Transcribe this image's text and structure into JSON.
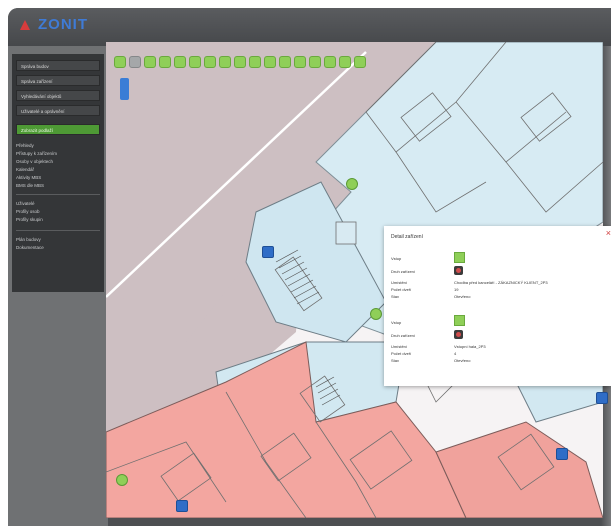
{
  "app": {
    "title": "ZONIT"
  },
  "sidebar": {
    "buttons": [
      "Správa budov",
      "Správa zařízení",
      "Vyhledávání objektů",
      "Uživatelé a oprávnění",
      "Zobrazit podlaží"
    ],
    "links1": [
      "Přehledy",
      "Přístupy k zařízením",
      "Osoby v objektech",
      "Kalendář",
      "Aktivity MBS",
      "BMS dle MBS"
    ],
    "links2": [
      "Uživatelé",
      "Profily osob",
      "Profily skupin"
    ],
    "links3": [
      "Plán budovy",
      "Dokumentace"
    ]
  },
  "toolbar": {
    "count": 17
  },
  "popup": {
    "title": "Detail zařízení",
    "sections": [
      {
        "header": "Vstup",
        "rows": [
          {
            "label": "Druh zařízení",
            "value": ""
          },
          {
            "label": "Umístění",
            "value": "Chodba před kanceláří - ZÁKAZNICKÝ KLIENT_2P3"
          },
          {
            "label": "Počet dveří",
            "value": "19"
          },
          {
            "label": "Stav",
            "value": "Otevřeno"
          }
        ]
      },
      {
        "header": "Vstup",
        "rows": [
          {
            "label": "Druh zařízení",
            "value": ""
          },
          {
            "label": "Umístění",
            "value": "Vstupní hala_2P3"
          },
          {
            "label": "Počet dveří",
            "value": "4"
          },
          {
            "label": "Stav",
            "value": "Otevřeno"
          }
        ]
      }
    ]
  },
  "colors": {
    "accent": "#8fcf58",
    "sidebar_active": "#4e9a35",
    "room_pink": "#f3a6a0",
    "room_blue": "#cfe6f0",
    "grey_zone": "#cdbfc2"
  }
}
